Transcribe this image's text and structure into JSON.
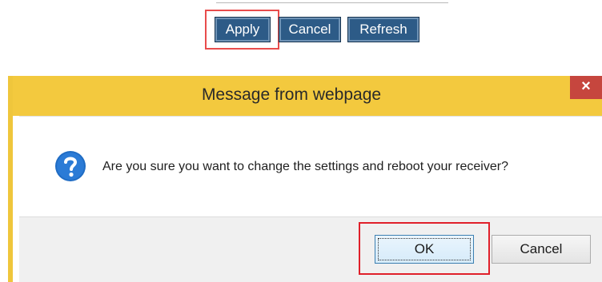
{
  "form": {
    "apply_label": "Apply",
    "cancel_label": "Cancel",
    "refresh_label": "Refresh"
  },
  "dialog": {
    "title": "Message from webpage",
    "close_glyph": "×",
    "message": "Are you sure you want to change the settings and reboot your receiver?",
    "ok_label": "OK",
    "cancel_label": "Cancel"
  },
  "colors": {
    "form_button": "#2d5b87",
    "titlebar": "#f3c93e",
    "close_button": "#c6463e",
    "highlight": "#e0202a",
    "question_icon": "#1f6cc4"
  }
}
